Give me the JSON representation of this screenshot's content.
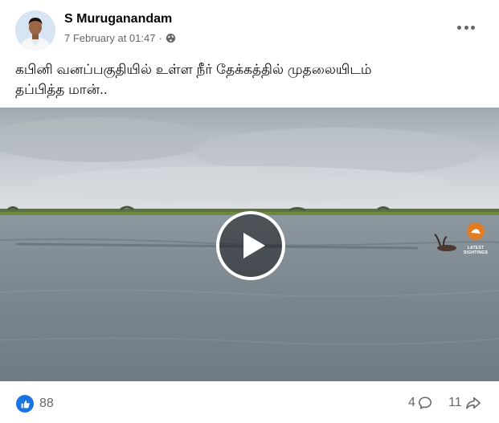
{
  "post": {
    "author": "S Muruganandam",
    "timestamp": "7 February at 01:47",
    "separator": "·",
    "audience_icon": "globe-icon",
    "caption_line1": "கபினி வனப்பகுதியில் உள்ள நீர் தேக்கத்தில் முதலையிடம்",
    "caption_line2": "தப்பித்த மான்..",
    "video": {
      "watermark_text": "LATEST SIGHTINGS",
      "play_icon": "play-icon"
    },
    "footer": {
      "reaction_icon": "like-icon",
      "reactions_count": "88",
      "comments_count": "4",
      "comment_icon": "comment-icon",
      "shares_count": "11",
      "share_icon": "share-icon"
    }
  },
  "colors": {
    "accent": "#1b74e4",
    "secondary_text": "#65676b",
    "primary_text": "#050505"
  }
}
